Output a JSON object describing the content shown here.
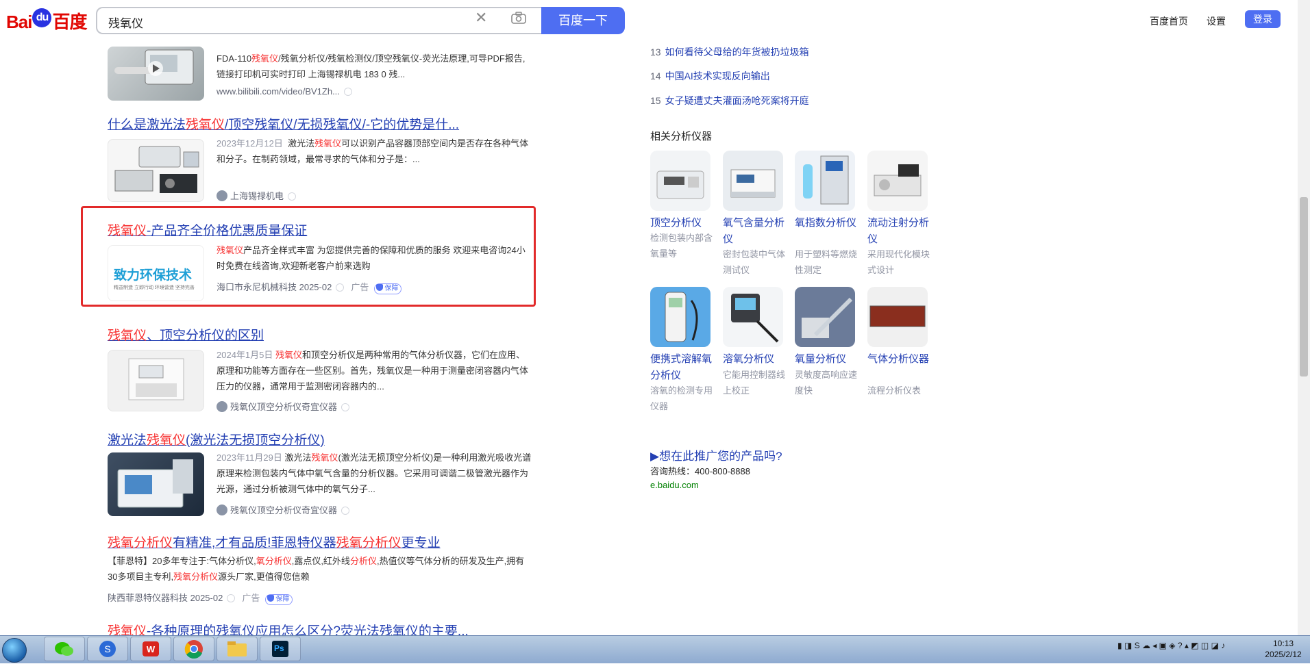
{
  "header": {
    "logo": {
      "left": "Bai",
      "paw": "du",
      "right": "百度"
    },
    "search_value": "残氧仪",
    "search_button": "百度一下",
    "links": [
      "百度首页",
      "设置"
    ],
    "login": "登录"
  },
  "results": [
    {
      "abstract_before": "FDA-110",
      "abstract_hl": "残氧仪",
      "abstract_after": "/残氧分析仪/残氧检测仪/顶空残氧仪-荧光法原理,可导PDF报告,链接打印机可实时打印 上海锡禄机电 183 0 残...",
      "url": "www.bilibili.com/video/BV1Zh..."
    },
    {
      "title_before": "什么是激光法",
      "title_hl": "残氧仪",
      "title_after": "/顶空残氧仪/无损残氧仪/-它的优势是什...",
      "date": "2023年12月12日",
      "abstract_before": "激光法",
      "abstract_hl": "残氧仪",
      "abstract_after": "可以识别产品容器顶部空间内是否存在各种气体和分子。在制药领域，最常寻求的气体和分子是：...",
      "source": "上海锡禄机电"
    },
    {
      "title_hl": "残氧仪",
      "title_after": "-产品齐全价格优惠质量保证",
      "abstract_hl": "残氧仪",
      "abstract_after": "产品齐全样式丰富 为您提供完善的保障和优质的服务 欢迎来电咨询24小时免费在线咨询,欢迎新老客户前来选购",
      "source": "海口市永尼机械科技 2025-02",
      "ad": "广告",
      "guard": "保障",
      "thumb_text": "致力环保技术",
      "thumb_sub": "精益制造  立即行动  环境营造  坚持完善"
    },
    {
      "title_hl": "残氧仪",
      "title_after": "、顶空分析仪的区别",
      "date": "2024年1月5日",
      "abstract_hl": "残氧仪",
      "abstract_after": "和顶空分析仪是两种常用的气体分析仪器，它们在应用、原理和功能等方面存在一些区别。首先，残氧仪是一种用于测量密闭容器内气体压力的仪器，通常用于监测密闭容器内的...",
      "source": "残氧仪顶空分析仪奇宜仪器"
    },
    {
      "title_before": "激光法",
      "title_hl": "残氧仪",
      "title_after": "(激光法无损顶空分析仪)",
      "date": "2023年11月29日",
      "abstract_before": "激光法",
      "abstract_hl": "残氧仪",
      "abstract_after": "(激光法无损顶空分析仪)是一种利用激光吸收光谱原理来检测包装内气体中氧气含量的分析仪器。它采用可调谐二极管激光器作为光源，通过分析被测气体中的氧气分子...",
      "source": "残氧仪顶空分析仪奇宜仪器"
    },
    {
      "title_hl1": "残氧分析仪",
      "title_mid": "有精准,才有品质!菲恩特仪器",
      "title_hl2": "残氧分析仪",
      "title_after": "更专业",
      "abstract_p1": "【菲恩特】20多年专注于:气体分析仪,",
      "abstract_h1": "氧分析仪",
      "abstract_p2": ",露点仪,红外线",
      "abstract_h2": "分析仪",
      "abstract_p3": ",热值仪等气体分析的研发及生产,拥有30多项目主专利,",
      "abstract_h3": "残氧分析仪",
      "abstract_p4": "源头厂家,更值得您信赖",
      "source": "陕西菲恩特仪器科技 2025-02",
      "ad": "广告",
      "guard": "保障"
    },
    {
      "title_hl": "残氧仪",
      "title_after": "-各种原理的残氧仪应用怎么区分?荧光法残氧仪的主要..."
    }
  ],
  "hot_list": [
    {
      "num": "13",
      "text": "如何看待父母给的年货被扔垃圾箱"
    },
    {
      "num": "14",
      "text": "中国AI技术实现反向输出"
    },
    {
      "num": "15",
      "text": "女子疑遭丈夫灌面汤呛死案将开庭"
    }
  ],
  "related": {
    "title": "相关分析仪器",
    "items": [
      {
        "name": "顶空分析仪",
        "desc": "检测包装内部含氧量等"
      },
      {
        "name": "氧气含量分析仪",
        "desc": "密封包装中气体测试仪"
      },
      {
        "name": "氧指数分析仪",
        "desc": "用于塑料等燃烧性测定"
      },
      {
        "name": "流动注射分析仪",
        "desc": "采用现代化模块式设计"
      },
      {
        "name": "便携式溶解氧分析仪",
        "desc": "溶氧的检测专用仪器"
      },
      {
        "name": "溶氧分析仪",
        "desc": "它能用控制器线上校正"
      },
      {
        "name": "氧量分析仪",
        "desc": "灵敏度高响应速度快"
      },
      {
        "name": "气体分析仪器",
        "desc": "流程分析仪表"
      }
    ]
  },
  "promo": {
    "title": "▶想在此推广您的产品吗?",
    "hotline": "咨询热线：400-800-8888",
    "url": "e.baidu.com"
  },
  "taskbar": {
    "ps_label": "Ps",
    "time": "10:13",
    "date": "2025/2/12"
  },
  "colors": {
    "accent": "#4e6ef2",
    "link": "#2440b3",
    "highlight": "#f73131",
    "box": "#e22a2a"
  }
}
